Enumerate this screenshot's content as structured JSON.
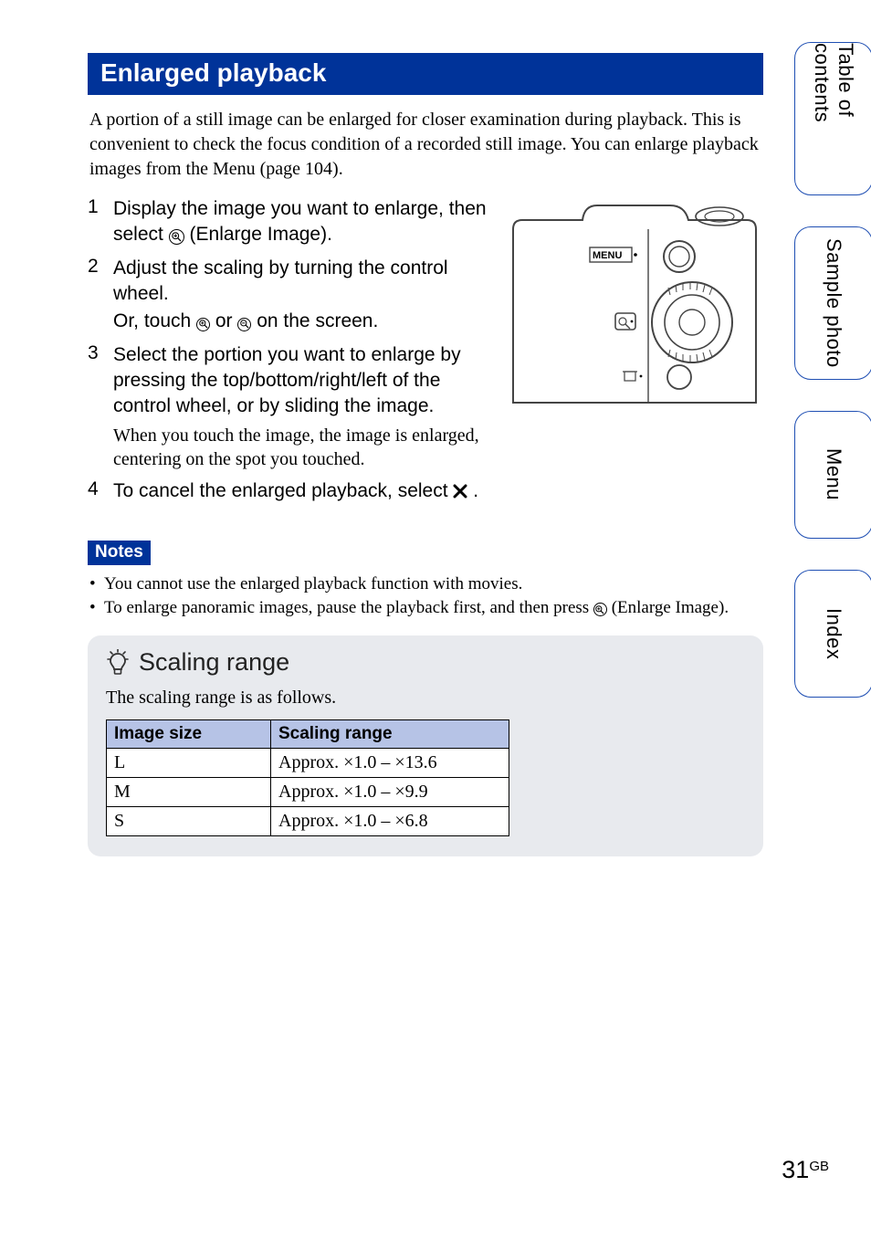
{
  "side_tabs": {
    "toc": "Table of contents",
    "sample": "Sample photo",
    "menu": "Menu",
    "index": "Index"
  },
  "heading": "Enlarged playback",
  "intro": "A portion of a still image can be enlarged for closer examination during playback. This is convenient to check the focus condition of a recorded still image. You can enlarge playback images from the Menu (page 104).",
  "steps": {
    "s1": {
      "num": "1",
      "line_a": "Display the image you want to enlarge, then",
      "line_b_pre": "select ",
      "line_b_post": " (Enlarge Image)."
    },
    "s2": {
      "num": "2",
      "line_a": "Adjust the scaling by turning the control",
      "line_b": "wheel.",
      "sub_pre": "Or, touch ",
      "sub_mid": " or ",
      "sub_post": " on the screen."
    },
    "s3": {
      "num": "3",
      "line_a": "Select the portion you want to enlarge by",
      "line_b": "pressing the top/bottom/right/left of the",
      "line_c": "control wheel, or by sliding the image.",
      "note": "When you touch the image, the image is enlarged, centering on the spot you touched."
    },
    "s4": {
      "num": "4",
      "line_pre": "To cancel the enlarged playback, select ",
      "line_post": " ."
    }
  },
  "camera_label": "MENU",
  "notes": {
    "label": "Notes",
    "items": {
      "n1": "You cannot use the enlarged playback function with movies.",
      "n2_pre": "To enlarge panoramic images, pause the playback first, and then press ",
      "n2_post": " (Enlarge Image)."
    }
  },
  "tip": {
    "heading": "Scaling range",
    "lead": "The scaling range is as follows.",
    "th1": "Image size",
    "th2": "Scaling range"
  },
  "chart_data": {
    "type": "table",
    "columns": [
      "Image size",
      "Scaling range"
    ],
    "rows": [
      {
        "size": "L",
        "range": "Approx. ×1.0 – ×13.6"
      },
      {
        "size": "M",
        "range": "Approx. ×1.0 – ×9.9"
      },
      {
        "size": "S",
        "range": "Approx. ×1.0 – ×6.8"
      }
    ]
  },
  "page_number": {
    "num": "31",
    "suffix": "GB"
  }
}
